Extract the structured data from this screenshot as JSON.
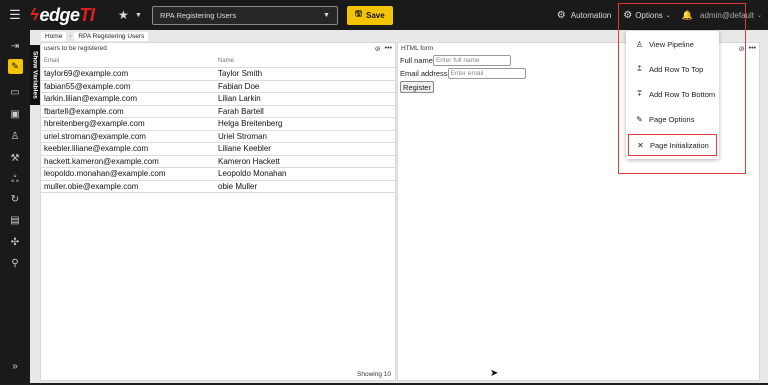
{
  "topbar": {
    "logo_main": "edge",
    "logo_accent": "TI",
    "page_select_value": "RPA Registering Users",
    "save_label": "Save",
    "automation_label": "Automation",
    "options_label": "Options",
    "user_label": "admin@default"
  },
  "breadcrumb": {
    "home": "Home",
    "current": "RPA Registering Users"
  },
  "vars_tab_label": "Show Variables",
  "left_panel": {
    "title": "users to be registered",
    "columns": {
      "email": "Email",
      "name": "Name"
    },
    "rows": [
      {
        "email": "taylor69@example.com",
        "name": "Taylor Smith"
      },
      {
        "email": "fabian55@example.com",
        "name": "Fabian Doe"
      },
      {
        "email": "larkin.lilian@example.com",
        "name": "Lilian Larkin"
      },
      {
        "email": "fbartell@example.com",
        "name": "Farah Bartell"
      },
      {
        "email": "hbreitenberg@example.com",
        "name": "Helga Breitenberg"
      },
      {
        "email": "uriel.stroman@example.com",
        "name": "Uriel Stroman"
      },
      {
        "email": "keebler.liliane@example.com",
        "name": "Liliane Keebler"
      },
      {
        "email": "hackett.kameron@example.com",
        "name": "Kameron Hackett"
      },
      {
        "email": "leopoldo.monahan@example.com",
        "name": "Leopoldo Monahan"
      },
      {
        "email": "muller.obie@example.com",
        "name": "obie Muller"
      }
    ],
    "footer": "Showing 10"
  },
  "right_panel": {
    "title": "HTML form",
    "fullname_label": "Full name",
    "fullname_placeholder": "Enter full name",
    "email_label": "Email address",
    "email_placeholder": "Enter email",
    "register_label": "Register"
  },
  "options_menu": {
    "items": [
      {
        "label": "View Pipeline",
        "icon": "pipeline-icon"
      },
      {
        "label": "Add Row To Top",
        "icon": "add-row-top-icon"
      },
      {
        "label": "Add Row To Bottom",
        "icon": "add-row-bottom-icon"
      },
      {
        "label": "Page Options",
        "icon": "pencil-icon"
      },
      {
        "label": "Page Initialization",
        "icon": "tools-icon"
      }
    ]
  },
  "colors": {
    "accent": "#f5c400",
    "highlight": "#e03a3a",
    "topbar_bg": "#1a1a1a"
  }
}
